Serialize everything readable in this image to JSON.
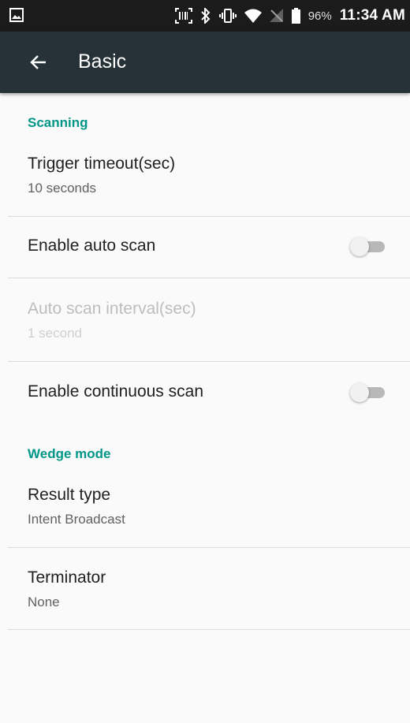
{
  "status_bar": {
    "icons": [
      "image-icon",
      "barcode-scan-icon",
      "bluetooth-icon",
      "vibrate-icon",
      "wifi-icon",
      "no-sim-icon",
      "battery-icon"
    ],
    "battery": "96%",
    "time": "11:34 AM"
  },
  "app_bar": {
    "back_icon": "arrow-back-icon",
    "title": "Basic"
  },
  "sections": {
    "scanning": {
      "header": "Scanning",
      "trigger_timeout": {
        "title": "Trigger timeout(sec)",
        "summary": "10 seconds"
      },
      "enable_auto_scan": {
        "title": "Enable auto scan",
        "checked": false
      },
      "auto_scan_interval": {
        "title": "Auto scan interval(sec)",
        "summary": "1 second",
        "enabled": false
      },
      "enable_continuous_scan": {
        "title": "Enable continuous scan",
        "checked": false
      }
    },
    "wedge_mode": {
      "header": "Wedge mode",
      "result_type": {
        "title": "Result type",
        "summary": "Intent Broadcast"
      },
      "terminator": {
        "title": "Terminator",
        "summary": "None"
      }
    }
  },
  "colors": {
    "status_bar": "#1b1b1b",
    "app_bar": "#263238",
    "accent": "#009688",
    "background": "#fafafa"
  }
}
